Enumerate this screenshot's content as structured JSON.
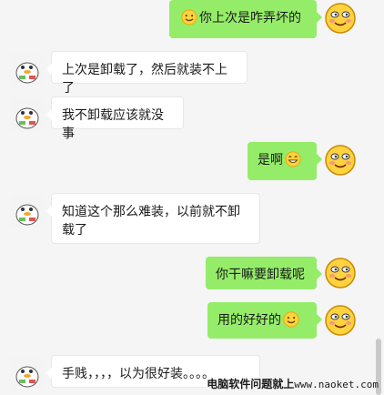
{
  "conversation": {
    "messages": [
      {
        "side": "out",
        "text_before": "",
        "emoji": "smile",
        "text_after": "你上次是咋弄坏的"
      },
      {
        "side": "in",
        "text": "上次是卸载了，然后就装不上了"
      },
      {
        "side": "in",
        "text": "我不卸载应该就没事"
      },
      {
        "side": "out",
        "text_before": "是啊",
        "emoji": "grin",
        "text_after": ""
      },
      {
        "side": "in",
        "text": "知道这个那么难装，以前就不卸载了"
      },
      {
        "side": "out",
        "text_before": "你干嘛要卸载呢",
        "emoji": "",
        "text_after": ""
      },
      {
        "side": "out",
        "text_before": "用的好好的",
        "emoji": "smile",
        "text_after": ""
      },
      {
        "side": "in",
        "text": "手贱，，，，以为很好装。。。。"
      }
    ]
  },
  "watermark": {
    "cn": "电脑软件问题就上",
    "url": "www.naoket.com"
  },
  "colors": {
    "background": "#f5f5f5",
    "outgoing_bubble": "#95ec69",
    "incoming_bubble": "#ffffff",
    "emoji_face": "#ffd23f"
  }
}
